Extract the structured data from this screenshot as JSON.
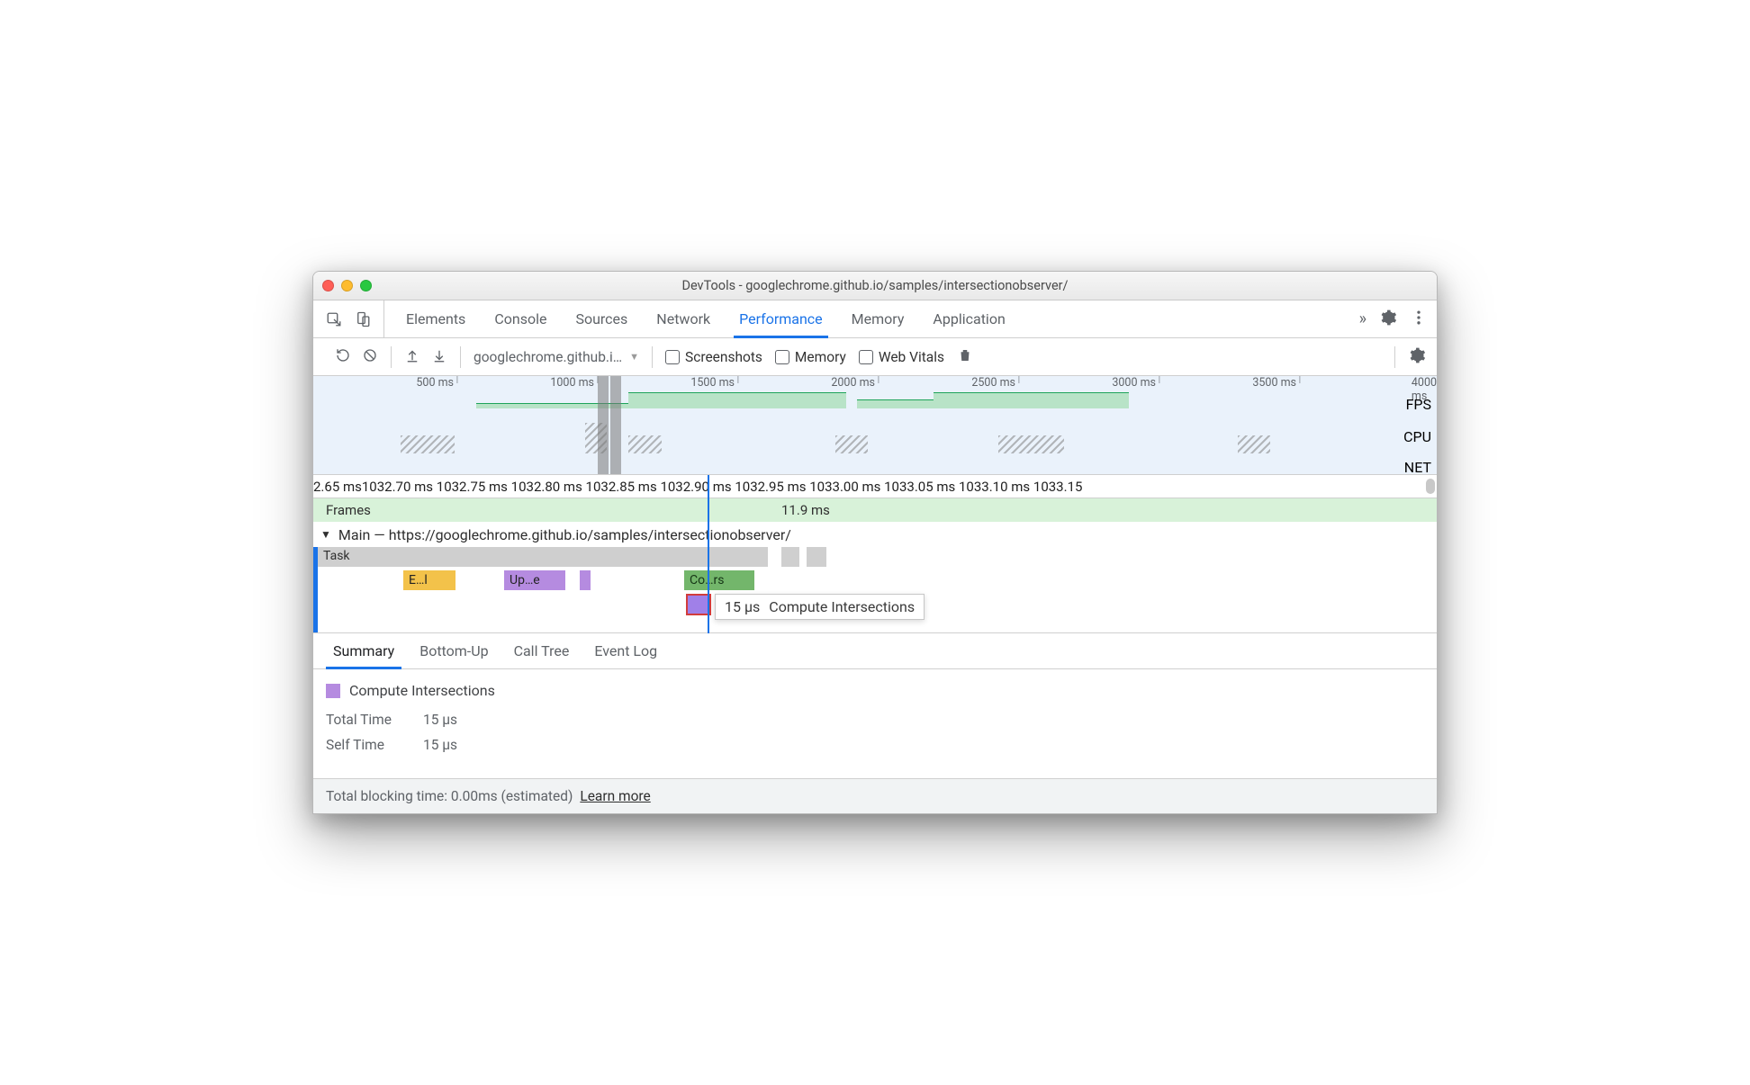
{
  "window": {
    "title": "DevTools - googlechrome.github.io/samples/intersectionobserver/"
  },
  "tabs": {
    "items": [
      "Elements",
      "Console",
      "Sources",
      "Network",
      "Performance",
      "Memory",
      "Application"
    ],
    "active": "Performance",
    "overflow_glyph": "»"
  },
  "toolbar": {
    "recording_label": "googlechrome.github.i…",
    "checkboxes": {
      "screenshots": "Screenshots",
      "memory": "Memory",
      "web_vitals": "Web Vitals"
    }
  },
  "overview": {
    "ticks": [
      "500 ms",
      "1000 ms",
      "1500 ms",
      "2000 ms",
      "2500 ms",
      "3000 ms",
      "3500 ms",
      "4000 ms"
    ],
    "lane_labels": {
      "fps": "FPS",
      "cpu": "CPU",
      "net": "NET"
    }
  },
  "detail_ruler": {
    "ticks": [
      "2.65 ms",
      "1032.70 ms",
      "1032.75 ms",
      "1032.80 ms",
      "1032.85 ms",
      "1032.90 ms",
      "1032.95 ms",
      "1033.00 ms",
      "1033.05 ms",
      "1033.10 ms",
      "1033.15"
    ]
  },
  "frames": {
    "label": "Frames",
    "value": "11.9 ms"
  },
  "main_thread": {
    "header": "Main — https://googlechrome.github.io/samples/intersectionobserver/",
    "task_label": "Task",
    "events": {
      "gold": "E…l",
      "purple": "Up…e",
      "green": "Co…rs"
    },
    "tooltip": {
      "duration": "15 µs",
      "name": "Compute Intersections"
    }
  },
  "detail_tabs": {
    "items": [
      "Summary",
      "Bottom-Up",
      "Call Tree",
      "Event Log"
    ],
    "active": "Summary"
  },
  "summary": {
    "title": "Compute Intersections",
    "rows": [
      {
        "k": "Total Time",
        "v": "15 µs"
      },
      {
        "k": "Self Time",
        "v": "15 µs"
      }
    ]
  },
  "footer": {
    "text": "Total blocking time: 0.00ms (estimated)",
    "link": "Learn more"
  }
}
